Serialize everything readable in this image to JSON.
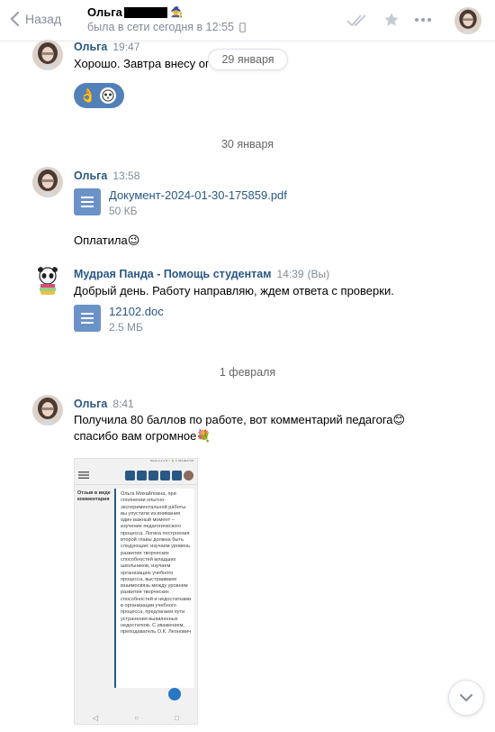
{
  "header": {
    "back_label": "Назад",
    "peer_name": "Ольга",
    "peer_status": "была в сети сегодня в 12:55"
  },
  "floating_date": "29 января",
  "messages": [
    {
      "author": "Ольга",
      "time": "19:47",
      "text": "Хорошо. Завтра внесу ог"
    },
    {
      "date_sep": "30 января"
    },
    {
      "author": "Ольга",
      "time": "13:58",
      "doc": {
        "name": "Документ-2024-01-30-175859.pdf",
        "size": "50 КБ"
      },
      "text": "Оплатила😉"
    },
    {
      "author": "Мудрая Панда - Помощь студентам",
      "time": "14:39",
      "suffix": "(Вы)",
      "text": "Добрый день. Работу направляю, ждем ответа с проверки.",
      "doc": {
        "name": "12102.doc",
        "size": "2.5 МБ"
      }
    },
    {
      "date_sep": "1 февраля"
    },
    {
      "author": "Ольга",
      "time": "8:41",
      "text_line1": "Получила 80 баллов по работе, вот комментарий педагога😊",
      "text_line2": "спасибо вам огромное💐"
    }
  ],
  "screenshot": {
    "status_bar": "Меню ● ● ●        ✉ ⚡ 🔋 ✶ 66% ■ 07:08",
    "label": "Отзыв в виде комментария",
    "comment": "Ольга Михайловна, при сполнении опытно- экспериментальной работы вы упустили из внимания один важный момент – изучение педагогического процесса. Логика построения второй главы должна быть следующая: изучаем уровень развития творческих способностей младших школьников, изучаем организацию учебного процесса, выстраиваем взаимосвязь между уровнем развития творческих способностей и недостатками в организации учебного процесса, предлагаем пути устранения выявленных недостатков. С уважением, преподаватель О.К. Леонович"
  },
  "icons": {
    "back": "chevron-left-icon",
    "read": "double-check-icon",
    "star": "star-icon",
    "more": "more-icon",
    "scroll_down": "chevron-down-icon"
  },
  "colors": {
    "link": "#2a5885",
    "meta": "#818c99",
    "accent": "#5181b8"
  }
}
